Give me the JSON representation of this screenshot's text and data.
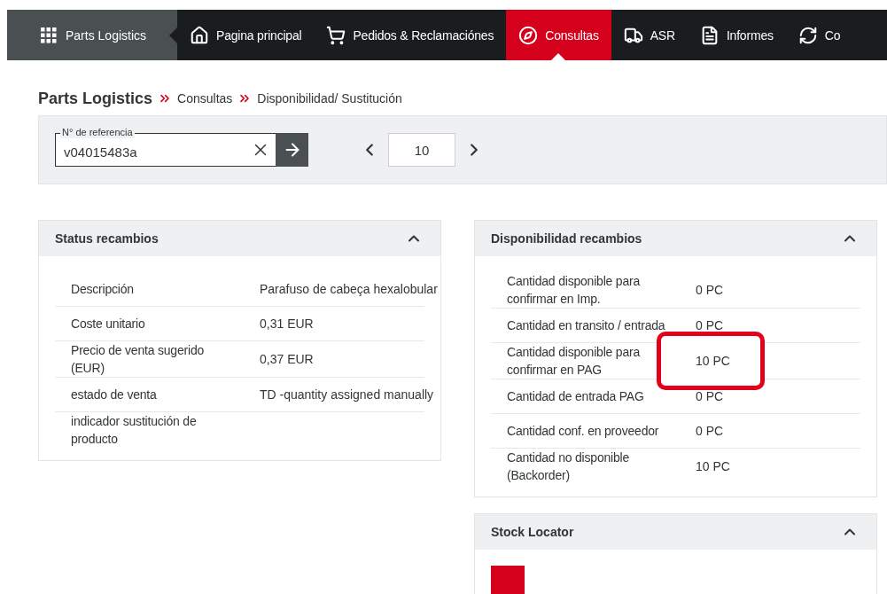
{
  "nav": {
    "app_label": "Parts Logistics",
    "items": [
      {
        "label": "Pagina principal",
        "selected": false
      },
      {
        "label": "Pedidos & Reclamaciónes",
        "selected": false
      },
      {
        "label": "Consultas",
        "selected": true
      },
      {
        "label": "ASR",
        "selected": false
      },
      {
        "label": "Informes",
        "selected": false
      },
      {
        "label": "Co",
        "selected": false
      }
    ]
  },
  "breadcrumb": [
    "Parts Logistics",
    "Consultas",
    "Disponibilidad/ Sustitución"
  ],
  "search": {
    "label": "N° de referencia",
    "value": "v04015483a"
  },
  "pager": {
    "value": "10"
  },
  "panels": [
    {
      "kind": "table",
      "title": "Status recambios",
      "expanded": true,
      "rows": [
        {
          "label": "Descripción",
          "value": "Parafuso de cabeça hexalobular",
          "highlighted": false
        },
        {
          "label": "Coste unitario",
          "value": "0,31 EUR",
          "highlighted": false
        },
        {
          "label": "Precio de venta sugerido (EUR)",
          "value": "0,37 EUR",
          "highlighted": false
        },
        {
          "label": "estado de venta",
          "value": "TD -quantity assigned manually",
          "highlighted": false
        },
        {
          "label": "indicador sustitución de producto"
        }
      ]
    },
    {
      "kind": "table",
      "title": "Disponibilidad recambios",
      "expanded": true,
      "rows": [
        {
          "label": "Cantidad disponible para confirmar en Imp.",
          "value": "0 PC",
          "highlighted": false
        },
        {
          "label": "Cantidad en transito / entrada",
          "value": "0 PC",
          "highlighted": false
        },
        {
          "label": "Cantidad disponible para confirmar en PAG",
          "value": "10 PC",
          "highlighted": true
        },
        {
          "label": "Cantidad de entrada PAG",
          "value": "0 PC",
          "highlighted": false
        },
        {
          "label": "Cantidad conf. en proveedor",
          "value": "0 PC",
          "highlighted": false
        },
        {
          "label": "Cantidad no disponible (Backorder)",
          "value": "10 PC",
          "highlighted": false
        }
      ]
    },
    {
      "kind": "locator",
      "title": "Stock Locator",
      "expanded": true
    }
  ]
}
